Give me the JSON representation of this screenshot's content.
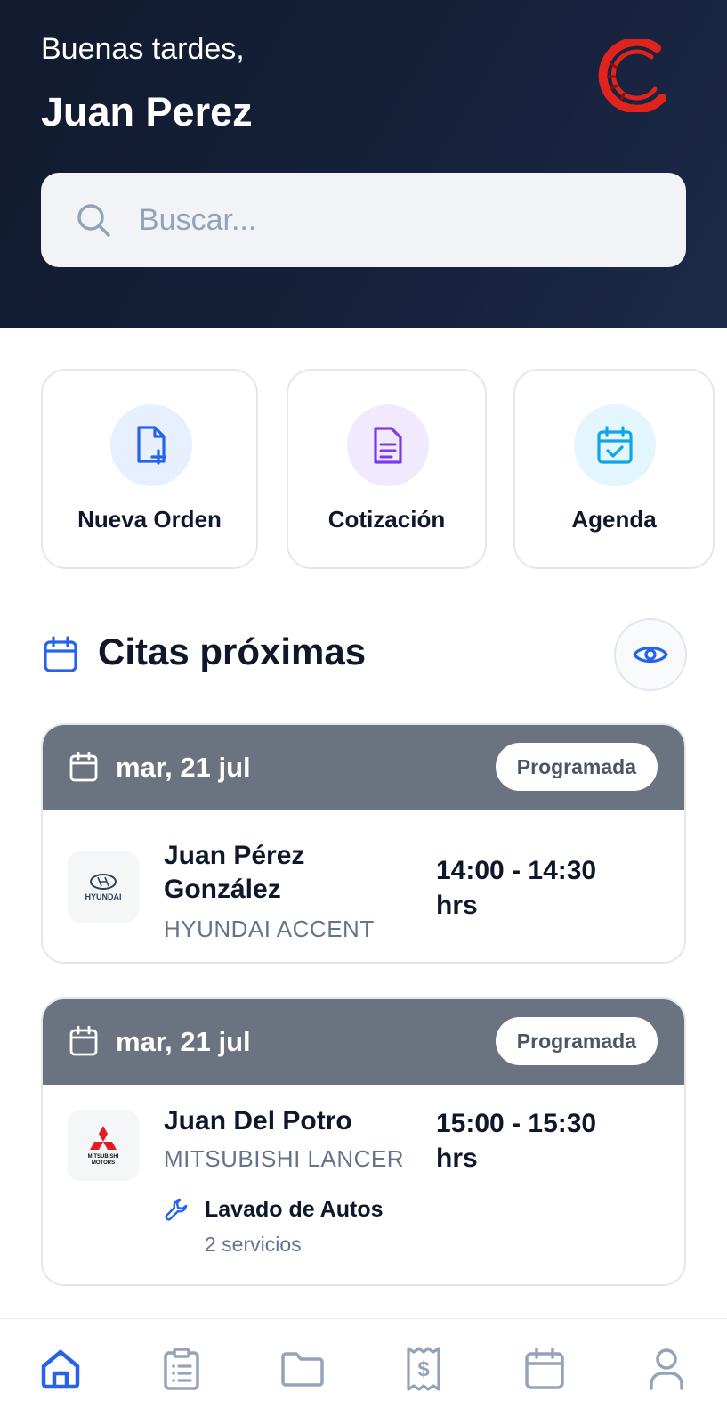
{
  "header": {
    "greeting": "Buenas tardes,",
    "user_name": "Juan Perez",
    "logo_icon": "brand-logo-icon"
  },
  "search": {
    "placeholder": "Buscar...",
    "icon": "search-icon"
  },
  "quick_actions": [
    {
      "label": "Nueva Orden",
      "icon": "file-plus-icon",
      "color": "#2563eb",
      "bg": "#e8efff"
    },
    {
      "label": "Cotización",
      "icon": "document-icon",
      "color": "#7c3aed",
      "bg": "#f1eaff"
    },
    {
      "label": "Agenda",
      "icon": "calendar-check-icon",
      "color": "#0ea5e9",
      "bg": "#e3f5fd"
    }
  ],
  "appointments_section": {
    "title": "Citas próximas",
    "icon": "calendar-icon",
    "toggle_icon": "eye-icon"
  },
  "appointments": [
    {
      "date": "mar, 21 jul",
      "status": "Programada",
      "client_line1": "Juan Pérez",
      "client_line2": "González",
      "vehicle": "HYUNDAI ACCENT",
      "time_line1": "14:00 - 14:30",
      "time_line2": "hrs",
      "brand_logo": "hyundai-logo",
      "brand_text": "HYUNDAI"
    },
    {
      "date": "mar, 21 jul",
      "status": "Programada",
      "client_line1": "Juan Del Potro",
      "vehicle": "MITSUBISHI LANCER",
      "time_line1": "15:00 - 15:30",
      "time_line2": "hrs",
      "brand_logo": "mitsubishi-logo",
      "brand_text": "MITSUBISHI MOTORS",
      "service_name": "Lavado de Autos",
      "service_count": "2 servicios",
      "service_icon": "wrench-icon"
    }
  ],
  "bottom_nav": [
    {
      "icon": "home-icon",
      "active": true
    },
    {
      "icon": "clipboard-icon",
      "active": false
    },
    {
      "icon": "folder-icon",
      "active": false
    },
    {
      "icon": "receipt-icon",
      "active": false
    },
    {
      "icon": "calendar-icon",
      "active": false
    },
    {
      "icon": "user-icon",
      "active": false
    }
  ],
  "colors": {
    "accent": "#2563eb",
    "inactive_nav": "#94a3b8",
    "card_header": "#6b7280",
    "header_bg": "#111a2e"
  }
}
